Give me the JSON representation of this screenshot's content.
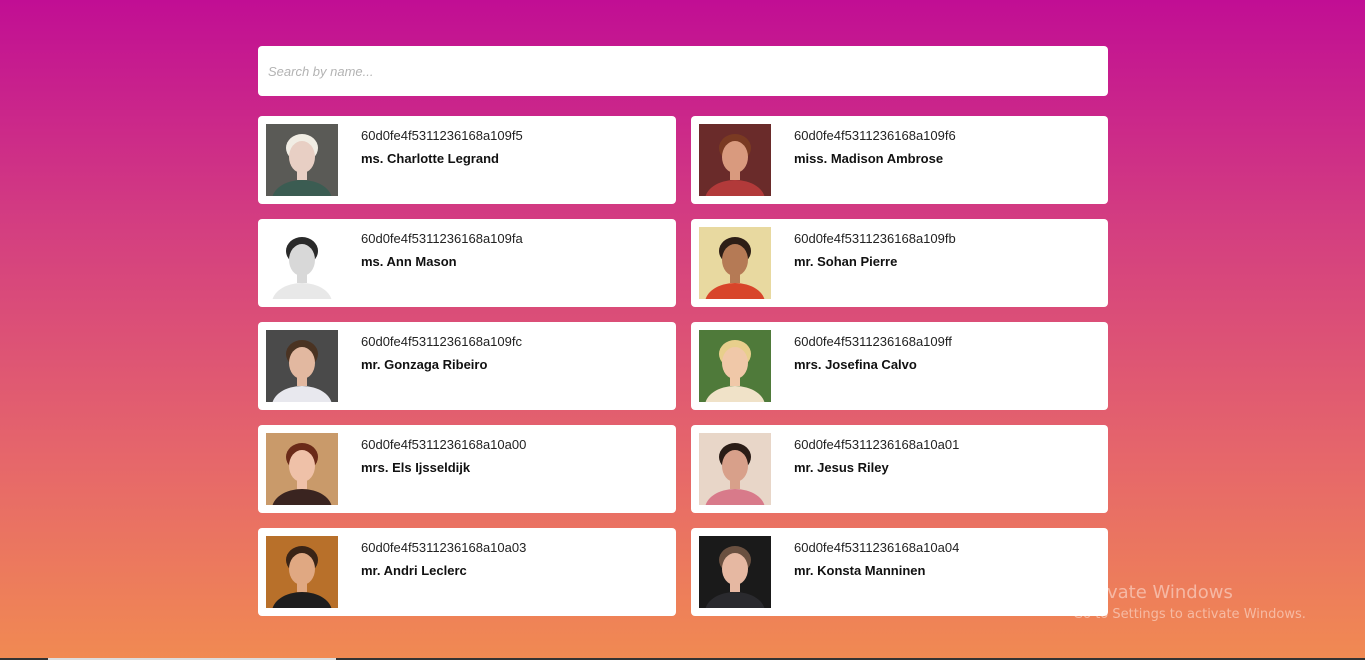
{
  "search": {
    "placeholder": "Search by name..."
  },
  "users": [
    {
      "id": "60d0fe4f5311236168a109f5",
      "name": "ms. Charlotte Legrand",
      "avatar": {
        "bg": "#5a5a56",
        "skin": "#e8cfc4",
        "hair": "#f1ede4",
        "shirt": "#3b5c52"
      }
    },
    {
      "id": "60d0fe4f5311236168a109f6",
      "name": "miss. Madison Ambrose",
      "avatar": {
        "bg": "#6a2b2a",
        "skin": "#d99a7e",
        "hair": "#7a3a22",
        "shirt": "#b23a3a"
      }
    },
    {
      "id": "60d0fe4f5311236168a109fa",
      "name": "ms. Ann Mason",
      "avatar": {
        "bg": "#ffffff",
        "skin": "#d8d8d8",
        "hair": "#2a2a2a",
        "shirt": "#e8e8e8"
      }
    },
    {
      "id": "60d0fe4f5311236168a109fb",
      "name": "mr. Sohan Pierre",
      "avatar": {
        "bg": "#e8d9a0",
        "skin": "#b57a55",
        "hair": "#2d1e16",
        "shirt": "#d8452a"
      }
    },
    {
      "id": "60d0fe4f5311236168a109fc",
      "name": "mr. Gonzaga Ribeiro",
      "avatar": {
        "bg": "#4a4a4a",
        "skin": "#e2b8a0",
        "hair": "#4a3322",
        "shirt": "#e8e8ee"
      }
    },
    {
      "id": "60d0fe4f5311236168a109ff",
      "name": "mrs. Josefina Calvo",
      "avatar": {
        "bg": "#4f7a3a",
        "skin": "#f0c8a8",
        "hair": "#e8cf8c",
        "shirt": "#f0e2c8"
      }
    },
    {
      "id": "60d0fe4f5311236168a10a00",
      "name": "mrs. Els Ijsseldijk",
      "avatar": {
        "bg": "#c99a6a",
        "skin": "#efc1a8",
        "hair": "#6a2a18",
        "shirt": "#3a2420"
      }
    },
    {
      "id": "60d0fe4f5311236168a10a01",
      "name": "mr. Jesus Riley",
      "avatar": {
        "bg": "#e8d6c8",
        "skin": "#d8a08a",
        "hair": "#2a1c16",
        "shirt": "#d87a8a"
      }
    },
    {
      "id": "60d0fe4f5311236168a10a03",
      "name": "mr. Andri Leclerc",
      "avatar": {
        "bg": "#b8702a",
        "skin": "#e0a882",
        "hair": "#3a2416",
        "shirt": "#1e1e1e"
      }
    },
    {
      "id": "60d0fe4f5311236168a10a04",
      "name": "mr. Konsta Manninen",
      "avatar": {
        "bg": "#1a1a1a",
        "skin": "#e6b8a2",
        "hair": "#6a5040",
        "shirt": "#2a2a2e"
      }
    }
  ],
  "watermark": {
    "title": "Activate Windows",
    "subtitle": "Go to Settings to activate Windows."
  }
}
